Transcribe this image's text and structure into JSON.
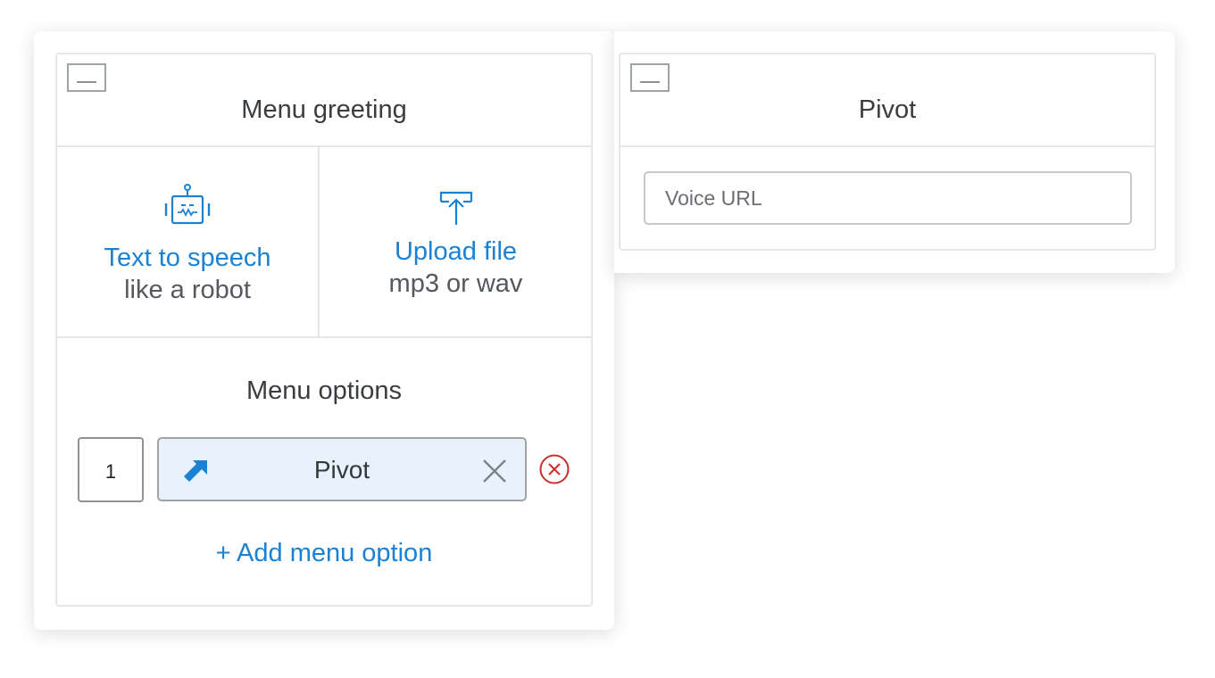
{
  "menu_panel": {
    "title": "Menu greeting",
    "tts": {
      "primary": "Text to speech",
      "secondary": "like a robot",
      "icon": "robot-icon"
    },
    "upload": {
      "primary": "Upload file",
      "secondary": "mp3 or wav",
      "icon": "upload-icon"
    },
    "options_title": "Menu options",
    "options": [
      {
        "number": "1",
        "label": "Pivot",
        "icon": "arrow-up-right-icon"
      }
    ],
    "add_option_label": "+ Add menu option"
  },
  "pivot_panel": {
    "title": "Pivot",
    "voice_url": {
      "placeholder": "Voice URL",
      "value": ""
    }
  },
  "colors": {
    "accent": "#1b82d3",
    "danger": "#c9302c",
    "pill_bg": "#e7f2fd",
    "border": "#e4e6e8"
  }
}
